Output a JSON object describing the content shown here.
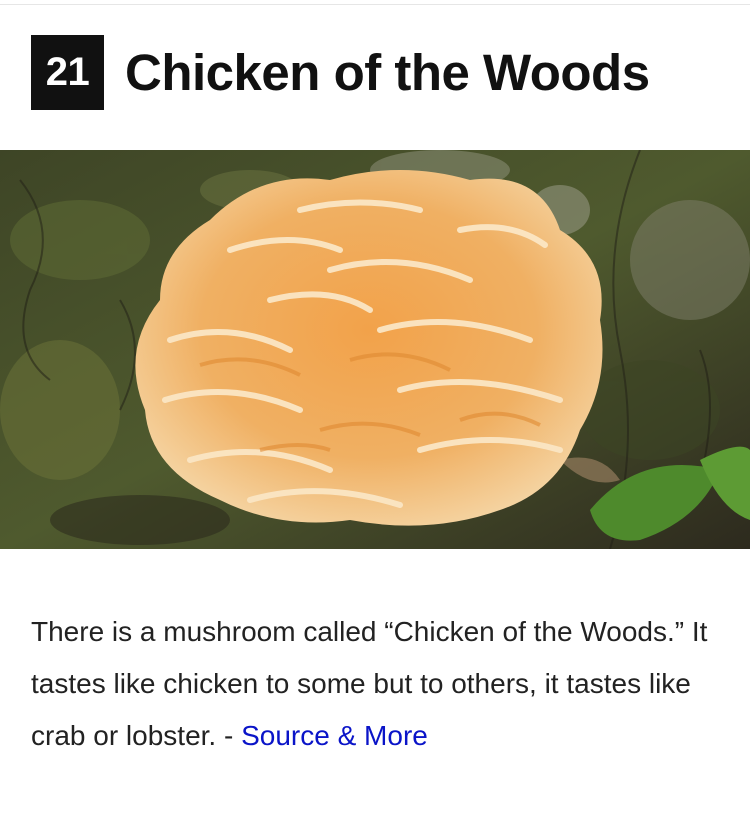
{
  "header": {
    "number": "21",
    "title": "Chicken of the Woods"
  },
  "image": {
    "subject": "orange shelf mushroom on tree bark"
  },
  "caption": {
    "text": "There is a mushroom called “Chicken of the Woods.” It tastes like chicken to some but to others, it tastes like crab or lobster. - ",
    "link_label": "Source & More"
  },
  "colors": {
    "badge_bg": "#111111",
    "link": "#0a14c8",
    "text": "#222222"
  }
}
